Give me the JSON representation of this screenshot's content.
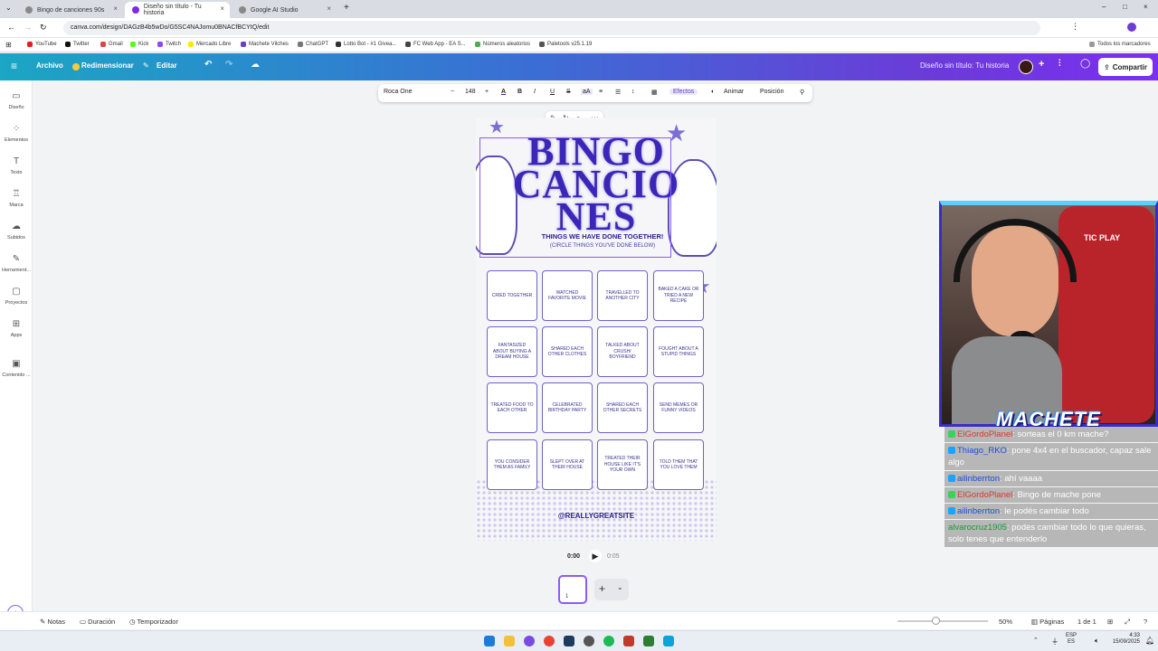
{
  "browser": {
    "tabs": [
      {
        "label": "Bingo de canciones 90s"
      },
      {
        "label": "Diseño sin título - Tu historia"
      },
      {
        "label": "Google AI Studio"
      }
    ],
    "url": "canva.com/design/DAGzB4b5wDo/G5SC4NAJomu0BNACfBCYtQ/edit",
    "bookmarks": [
      "YouTube",
      "Twitter",
      "Gmail",
      "Kick",
      "Twitch",
      "Mercado Libre",
      "Machete Vilches",
      "ChatGPT",
      "Lotto Bot - #1 Givea...",
      "FC Web App - EA S...",
      "Números aleatorios",
      "Paletools v25.1.19"
    ],
    "all_bookmarks": "Todos los marcadores"
  },
  "header": {
    "menu_icon": "menu-icon",
    "archivo": "Archivo",
    "redimensionar": "Redimensionar",
    "editar": "Editar",
    "doc_title": "Diseño sin título: Tu historia",
    "share": "Compartir"
  },
  "rail": [
    {
      "label": "Diseño",
      "icon": "design-icon"
    },
    {
      "label": "Elementos",
      "icon": "elements-icon"
    },
    {
      "label": "Texto",
      "icon": "text-icon"
    },
    {
      "label": "Marca",
      "icon": "brand-icon"
    },
    {
      "label": "Subidos",
      "icon": "upload-icon"
    },
    {
      "label": "Herramient...",
      "icon": "tools-icon"
    },
    {
      "label": "Proyectos",
      "icon": "folder-icon"
    },
    {
      "label": "Apps",
      "icon": "apps-icon"
    },
    {
      "label": "Contenido ...",
      "icon": "content-icon"
    }
  ],
  "toolbar": {
    "font": "Roca One",
    "minus": "−",
    "size": "148",
    "plus": "+",
    "efectos": "Efectos",
    "animar": "Animar",
    "posicion": "Posición"
  },
  "design": {
    "title_line1": "BINGO",
    "title_line2": "CANCIO",
    "title_line3": "NES",
    "sub1": "THINGS WE HAVE DONE TOGETHER!",
    "sub2": "(CIRCLE THINGS YOU'VE DONE BELOW)",
    "cells": [
      "CRIED TOGETHER",
      "WATCHED FAVORITE MOVIE",
      "TRAVELLED TO ANOTHER CITY",
      "BAKED A CAKE OR TRIED A NEW RECIPE",
      "FANTASIZED ABOUT BUYING A DREAM HOUSE",
      "SHARED EACH OTHER CLOTHES",
      "TALKED ABOUT CRUSH/ BOYFRIEND",
      "FOUGHT ABOUT A STUPID THINGS",
      "TREATED FOOD TO EACH OTHER",
      "CELEBRATED BIRTHDAY PARTY",
      "SHARED EACH OTHER SECRETS",
      "SEND MEMES OR FUNNY VIDEOS",
      "YOU CONSIDER THEM AS FAMILY",
      "SLEPT OVER AT THEIR HOUSE",
      "TREATED THEIR HOUSE LIKE IT'S YOUR OWN",
      "TOLD THEM THAT YOU LOVE THEM"
    ],
    "handle": "@REALLYGREATSITE"
  },
  "playback": {
    "time": "0:00",
    "duration": "0:05"
  },
  "page_thumb": {
    "count": "1"
  },
  "stream": {
    "overlay_name": "MACHETE",
    "brand": "TIC PLAY"
  },
  "chat": [
    {
      "user": "ElGordoPlanel",
      "text": ": sorteas el 0 km mache?",
      "color": "#d23a2a",
      "badge": "#3bd15a"
    },
    {
      "user": "Thiago_RKO",
      "text": ": pone 4x4 en el buscador, capaz sale algo",
      "color": "#1c4fd6",
      "badge": "#1aa3ff"
    },
    {
      "user": "ailinberrton",
      "text": ": ahí vaaaa",
      "color": "#1c4fd6",
      "badge": "#1aa3ff"
    },
    {
      "user": "ElGordoPlanel",
      "text": ": Bingo de mache pone",
      "color": "#d23a2a",
      "badge": "#3bd15a"
    },
    {
      "user": "ailinberrton",
      "text": ": le podés cambiar todo",
      "color": "#1c4fd6",
      "badge": "#1aa3ff"
    },
    {
      "user": "alvarocruz1905",
      "text": ": podes cambiar todo lo que quieras, solo tenes que entenderlo",
      "color": "#1a9a3a",
      "badge": ""
    }
  ],
  "bottom": {
    "notas": "Notas",
    "duracion": "Duración",
    "temporizador": "Temporizador",
    "zoom": "50%",
    "paginas": "Páginas",
    "page_of": "1 de 1"
  },
  "taskbar": {
    "lang": "ESP",
    "region": "ES",
    "time": "4:33",
    "date": "15/09/2025"
  }
}
